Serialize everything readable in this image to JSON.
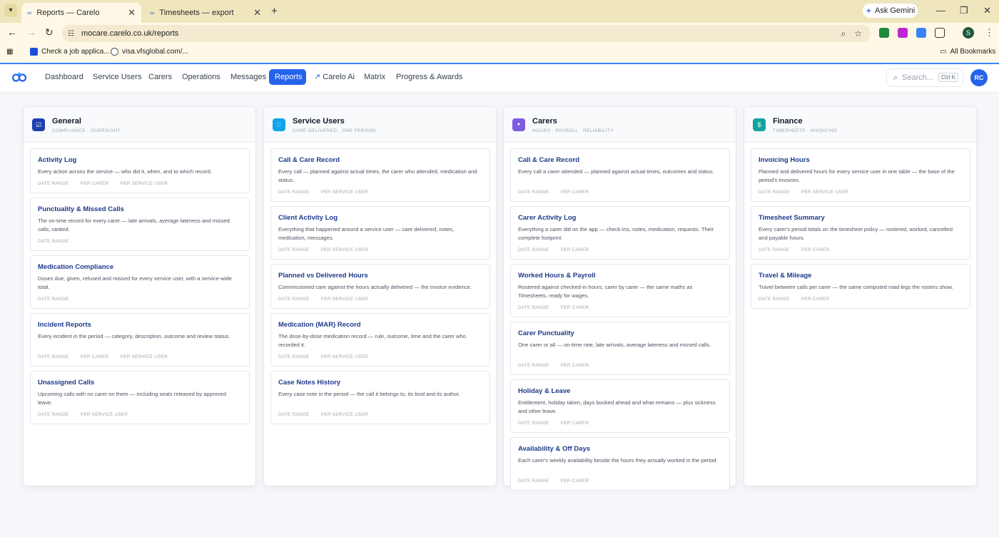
{
  "browser": {
    "tabs": [
      {
        "title": "Reports — Carelo",
        "active": true
      },
      {
        "title": "Timesheets — export",
        "active": false
      }
    ],
    "ask_gemini": "Ask Gemini",
    "url": "mocare.carelo.co.uk/reports",
    "profile_initial": "S",
    "bookmarks": [
      {
        "label": "Check a job applica..."
      },
      {
        "label": "visa.vfsglobal.com/..."
      }
    ],
    "all_bookmarks": "All Bookmarks"
  },
  "app": {
    "nav": [
      "Dashboard",
      "Service Users",
      "Carers",
      "Operations",
      "Messages",
      "Reports",
      "Carelo Ai",
      "Matrix",
      "Progress & Awards"
    ],
    "active_nav": "Reports",
    "search": {
      "placeholder": "Search...",
      "shortcut": "Ctrl K"
    },
    "avatar": "RC",
    "accent": "#2563eb"
  },
  "columns": [
    {
      "title": "General",
      "subtitle": "COMPLIANCE · OVERSIGHT",
      "icon": "check-square-icon",
      "color": "#1e40af",
      "cards": [
        {
          "title": "Activity Log",
          "desc": "Every action across the service — who did it, when, and to which record.",
          "tags": [
            "DATE RANGE",
            "PER CARER",
            "PER SERVICE USER"
          ]
        },
        {
          "title": "Punctuality & Missed Calls",
          "desc": "The on-time record for every carer — late arrivals, average lateness and missed calls, ranked.",
          "tags": [
            "DATE RANGE"
          ]
        },
        {
          "title": "Medication Compliance",
          "desc": "Doses due, given, refused and missed for every service user, with a service-wide total.",
          "tags": [
            "DATE RANGE"
          ]
        },
        {
          "title": "Incident Reports",
          "desc": "Every incident in the period — category, description, outcome and review status.",
          "tags": [
            "DATE RANGE",
            "PER CARER",
            "PER SERVICE USER"
          ]
        },
        {
          "title": "Unassigned Calls",
          "desc": "Upcoming calls with no carer on them — including seats released by approved leave.",
          "tags": [
            "DATE RANGE",
            "PER SERVICE USER"
          ]
        }
      ]
    },
    {
      "title": "Service Users",
      "subtitle": "CARE DELIVERED · ONE PERSON",
      "icon": "heart-icon",
      "color": "#0ea5e9",
      "cards": [
        {
          "title": "Call & Care Record",
          "desc": "Every call — planned against actual times, the carer who attended, medication and status.",
          "tags": [
            "DATE RANGE",
            "PER SERVICE USER"
          ]
        },
        {
          "title": "Client Activity Log",
          "desc": "Everything that happened around a service user — care delivered, notes, medication, messages.",
          "tags": [
            "DATE RANGE",
            "PER SERVICE USER"
          ]
        },
        {
          "title": "Planned vs Delivered Hours",
          "desc": "Commissioned care against the hours actually delivered — the invoice evidence.",
          "tags": [
            "DATE RANGE",
            "PER SERVICE USER"
          ]
        },
        {
          "title": "Medication (MAR) Record",
          "desc": "The dose-by-dose medication record — rule, outcome, time and the carer who recorded it.",
          "tags": [
            "DATE RANGE",
            "PER SERVICE USER"
          ]
        },
        {
          "title": "Case Notes History",
          "desc": "Every case note in the period — the call it belongs to, its kind and its author.",
          "tags": [
            "DATE RANGE",
            "PER SERVICE USER"
          ]
        }
      ]
    },
    {
      "title": "Carers",
      "subtitle": "HOURS · PAYROLL · RELIABILITY",
      "icon": "user-icon",
      "color": "#7c5ce0",
      "cards": [
        {
          "title": "Call & Care Record",
          "desc": "Every call a carer attended — planned against actual times, outcomes and status.",
          "tags": [
            "DATE RANGE",
            "PER CARER"
          ]
        },
        {
          "title": "Carer Activity Log",
          "desc": "Everything a carer did on the app — check-ins, notes, medication, requests. Their complete footprint.",
          "tags": [
            "DATE RANGE",
            "PER CARER"
          ]
        },
        {
          "title": "Worked Hours & Payroll",
          "desc": "Rostered against checked-in hours, carer by carer — the same maths as Timesheets, ready for wages.",
          "tags": [
            "DATE RANGE",
            "PER CARER"
          ]
        },
        {
          "title": "Carer Punctuality",
          "desc": "One carer or all — on-time rate, late arrivals, average lateness and missed calls.",
          "tags": [
            "DATE RANGE",
            "PER CARER"
          ]
        },
        {
          "title": "Holiday & Leave",
          "desc": "Entitlement, holiday taken, days booked ahead and what remains — plus sickness and other leave.",
          "tags": [
            "DATE RANGE",
            "PER CARER"
          ]
        },
        {
          "title": "Availability & Off Days",
          "desc": "Each carer's weekly availability beside the hours they actually worked in the period.",
          "tags": [
            "DATE RANGE",
            "PER CARER"
          ]
        }
      ]
    },
    {
      "title": "Finance",
      "subtitle": "TIMESHEETS · INVOICING",
      "icon": "dollar-icon",
      "color": "#14a3a0",
      "cards": [
        {
          "title": "Invoicing Hours",
          "desc": "Planned and delivered hours for every service user in one table — the base of the period's invoices.",
          "tags": [
            "DATE RANGE",
            "PER SERVICE USER"
          ]
        },
        {
          "title": "Timesheet Summary",
          "desc": "Every carer's period totals on the timesheet policy — rostered, worked, cancelled and payable hours.",
          "tags": [
            "DATE RANGE",
            "PER CARER"
          ]
        },
        {
          "title": "Travel & Mileage",
          "desc": "Travel between calls per carer — the same computed road legs the rosters show.",
          "tags": [
            "DATE RANGE",
            "PER CARER"
          ]
        }
      ]
    }
  ]
}
